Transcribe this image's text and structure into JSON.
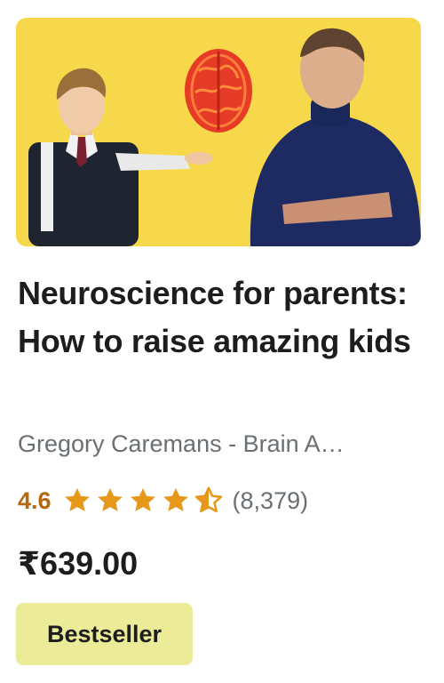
{
  "course": {
    "title": "Neuroscience for parents: How to raise amazing kids",
    "instructor": "Gregory Caremans - Brain A…",
    "rating": "4.6",
    "rating_stars": 4.6,
    "rating_count": "(8,379)",
    "price": "₹639.00",
    "badge": "Bestseller"
  },
  "colors": {
    "thumbnail_background": "#f7d84a",
    "rating_accent": "#b4690e",
    "star_color": "#e59819",
    "badge_background": "#eceb98"
  },
  "icons": {
    "star": "star-icon",
    "half_star": "star-half-icon"
  }
}
